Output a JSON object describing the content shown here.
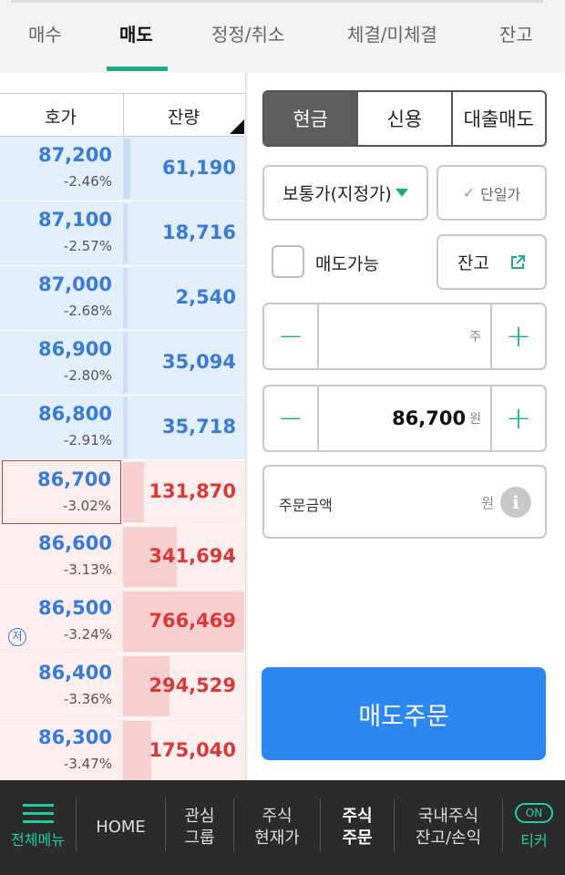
{
  "tabs": [
    {
      "label": "매수"
    },
    {
      "label": "매도"
    },
    {
      "label": "정정/취소"
    },
    {
      "label": "체결/미체결"
    },
    {
      "label": "잔고"
    }
  ],
  "orderbook": {
    "header_price": "호가",
    "header_qty": "잔량",
    "asks": [
      {
        "price": "87,200",
        "pct": "-2.46%",
        "qty": "61,190",
        "qty_ratio": 0.06
      },
      {
        "price": "87,100",
        "pct": "-2.57%",
        "qty": "18,716",
        "qty_ratio": 0.02
      },
      {
        "price": "87,000",
        "pct": "-2.68%",
        "qty": "2,540",
        "qty_ratio": 0.005
      },
      {
        "price": "86,900",
        "pct": "-2.80%",
        "qty": "35,094",
        "qty_ratio": 0.03
      },
      {
        "price": "86,800",
        "pct": "-2.91%",
        "qty": "35,718",
        "qty_ratio": 0.03
      }
    ],
    "bids": [
      {
        "price": "86,700",
        "pct": "-3.02%",
        "qty": "131,870",
        "qty_ratio": 0.17
      },
      {
        "price": "86,600",
        "pct": "-3.13%",
        "qty": "341,694",
        "qty_ratio": 0.44
      },
      {
        "price": "86,500",
        "pct": "-3.24%",
        "qty": "766,469",
        "qty_ratio": 1.0,
        "badge": "저"
      },
      {
        "price": "86,400",
        "pct": "-3.36%",
        "qty": "294,529",
        "qty_ratio": 0.38
      },
      {
        "price": "86,300",
        "pct": "-3.47%",
        "qty": "175,040",
        "qty_ratio": 0.23
      }
    ]
  },
  "order": {
    "segments": [
      "현금",
      "신용",
      "대출매도"
    ],
    "order_type": "보통가(지정가)",
    "single_price": "단일가",
    "sellable_label": "매도가능",
    "balance_label": "잔고",
    "qty_unit": "주",
    "price_value": "86,700",
    "price_unit": "원",
    "amount_label": "주문금액",
    "amount_unit": "원",
    "info_glyph": "i",
    "submit_label": "매도주문",
    "minus": "−",
    "plus": "+",
    "check_glyph": "✓"
  },
  "nav": {
    "menu_label": "전체메뉴",
    "home": "HOME",
    "watch_1": "관심",
    "watch_2": "그룹",
    "price_1": "주식",
    "price_2": "현재가",
    "order_1": "주식",
    "order_2": "주문",
    "domestic_1": "국내주식",
    "domestic_2": "잔고/손익",
    "ticker_on": "ON",
    "ticker": "티커"
  },
  "colors": {
    "accent": "#1aaa8a",
    "ask_blue": "#3a7bd5",
    "bid_red": "#d63a3a",
    "submit_blue": "#2d87f0"
  }
}
